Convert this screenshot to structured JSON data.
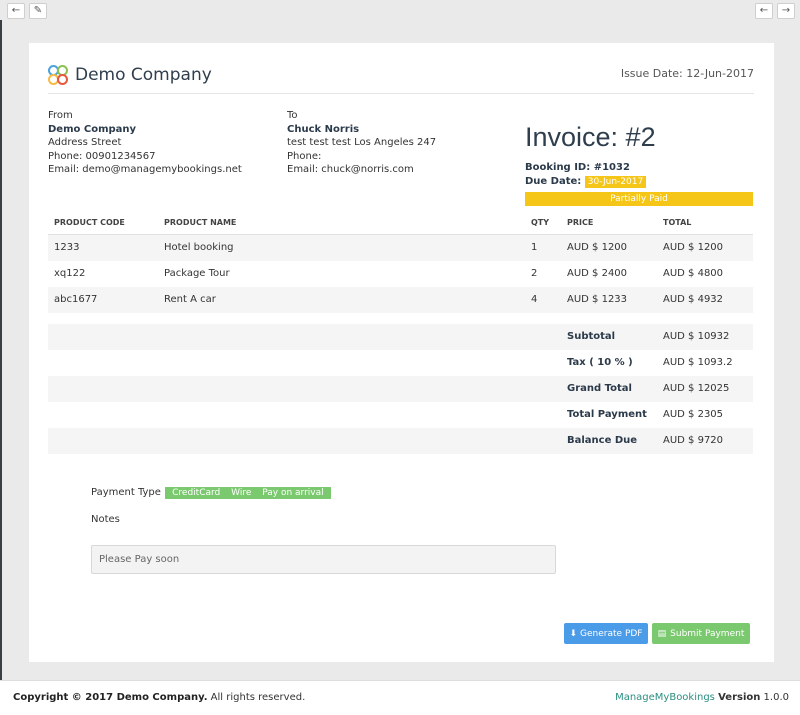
{
  "toolbar": {
    "back_icon": "arrow-left-icon",
    "edit_icon": "pencil-icon",
    "prev_icon": "arrow-left-icon",
    "next_icon": "arrow-right-icon"
  },
  "header": {
    "company_name": "Demo Company",
    "issue_date": "Issue Date: 12-Jun-2017",
    "logo_colors": [
      "#4aa3df",
      "#8cc152",
      "#f6bb42",
      "#e9573f"
    ]
  },
  "from": {
    "label": "From",
    "name": "Demo Company",
    "address": "Address Street",
    "phone": "Phone: 00901234567",
    "email": "Email: demo@managemybookings.net"
  },
  "to": {
    "label": "To",
    "name": "Chuck Norris",
    "address": "test test test Los Angeles 247",
    "phone": "Phone:",
    "email": "Email: chuck@norris.com"
  },
  "invoice": {
    "title": "Invoice: #2",
    "booking_id": "Booking ID: #1032",
    "due_label": "Due Date:",
    "due_date": "30-Jun-2017",
    "status": "Partially Paid",
    "status_color": "#f5c518"
  },
  "table": {
    "headers": [
      "PRODUCT CODE",
      "PRODUCT NAME",
      "QTY",
      "PRICE",
      "TOTAL"
    ],
    "rows": [
      {
        "code": "1233",
        "name": "Hotel booking",
        "qty": "1",
        "price": "AUD $ 1200",
        "total": "AUD $ 1200"
      },
      {
        "code": "xq122",
        "name": "Package Tour",
        "qty": "2",
        "price": "AUD $ 2400",
        "total": "AUD $ 4800"
      },
      {
        "code": "abc1677",
        "name": "Rent A car",
        "qty": "4",
        "price": "AUD $ 1233",
        "total": "AUD $ 4932"
      }
    ]
  },
  "totals": [
    {
      "label": "Subtotal",
      "value": "AUD $ 10932"
    },
    {
      "label": "Tax ( 10 % )",
      "value": "AUD $ 1093.2"
    },
    {
      "label": "Grand Total",
      "value": "AUD $ 12025"
    },
    {
      "label": "Total Payment",
      "value": "AUD $ 2305"
    },
    {
      "label": "Balance Due",
      "value": "AUD $ 9720"
    }
  ],
  "payment": {
    "label": "Payment Type",
    "types": [
      "CreditCard",
      "Wire",
      "Pay on arrival"
    ]
  },
  "notes": {
    "label": "Notes",
    "value": "Please Pay soon"
  },
  "actions": {
    "pdf_label": "Generate PDF",
    "pdf_icon": "download-icon",
    "pay_label": "Submit Payment",
    "pay_icon": "credit-card-icon"
  },
  "footer": {
    "copyright_bold": "Copyright © 2017 Demo Company.",
    "copyright_rest": " All rights reserved.",
    "brand": "ManageMyBookings",
    "version_label": "Version",
    "version": " 1.0.0"
  }
}
